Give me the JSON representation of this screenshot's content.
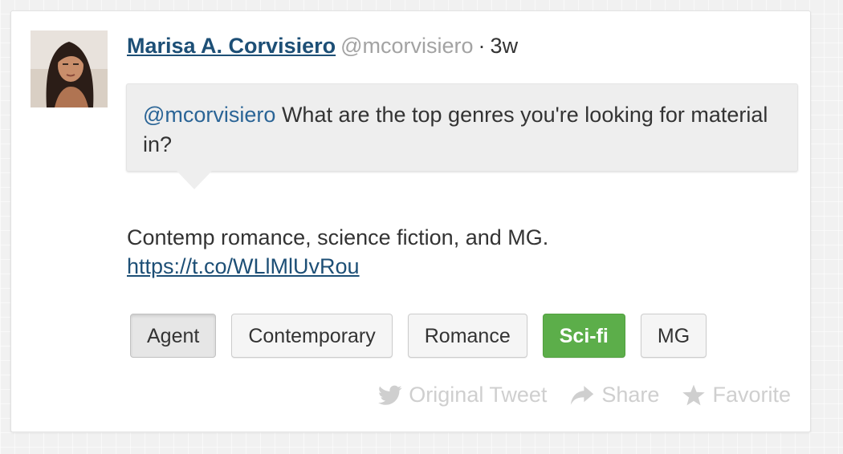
{
  "tweet": {
    "author_name": "Marisa A. Corvisiero",
    "handle": "@mcorvisiero",
    "separator": "·",
    "age": "3w",
    "question_mention": "@mcorvisiero",
    "question_text": " What are the top genres you're looking for material in?",
    "answer_text": "Contemp romance, science fiction, and MG.",
    "answer_link": "https://t.co/WLlMlUvRou"
  },
  "tags": [
    {
      "label": "Agent",
      "state": "active"
    },
    {
      "label": "Contemporary",
      "state": "default"
    },
    {
      "label": "Romance",
      "state": "default"
    },
    {
      "label": "Sci-fi",
      "state": "selected"
    },
    {
      "label": "MG",
      "state": "default"
    }
  ],
  "actions": {
    "original_tweet": "Original Tweet",
    "share": "Share",
    "favorite": "Favorite"
  },
  "icons": {
    "original_tweet": "twitter-bird-icon",
    "share": "share-arrow-icon",
    "favorite": "star-icon"
  },
  "colors": {
    "author": "#1d4f76",
    "mention": "#2a6496",
    "selected_tag": "#5cae4a",
    "muted_action": "#cfcfcf"
  }
}
